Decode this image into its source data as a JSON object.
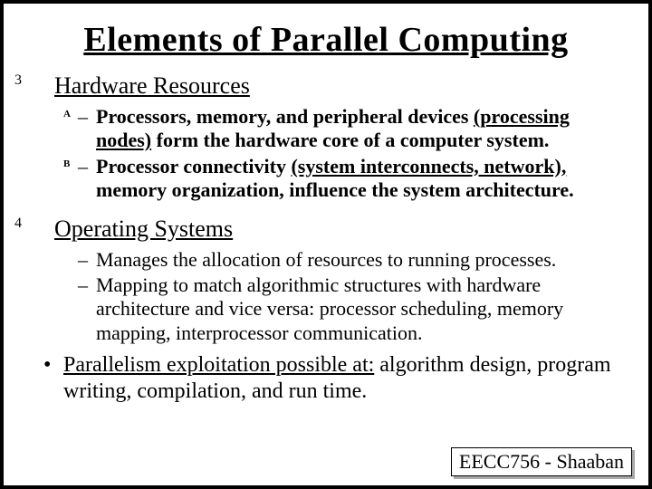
{
  "title": "Elements of Parallel Computing",
  "section1": {
    "num": "3",
    "title": "Hardware Resources",
    "itemA": {
      "tag": "A",
      "pre": "Processors, memory, and peripheral devices ",
      "u": "(processing nodes)",
      "post": " form the hardware core of a computer system."
    },
    "itemB": {
      "tag": "B",
      "pre": "Processor connectivity ",
      "u": "(system interconnects, network),",
      "post": " memory organization, influence the system architecture."
    }
  },
  "section2": {
    "num": "4",
    "title": "Operating Systems",
    "item1": "Manages the allocation of resources to running processes.",
    "item2": "Mapping to match algorithmic structures with hardware architecture and vice versa: processor scheduling, memory mapping, interprocessor communication."
  },
  "bullet": {
    "lead": "Parallelism exploitation possible at:",
    "rest": "  algorithm design, program writing, compilation, and run time."
  },
  "footer": "EECC756 - Shaaban"
}
